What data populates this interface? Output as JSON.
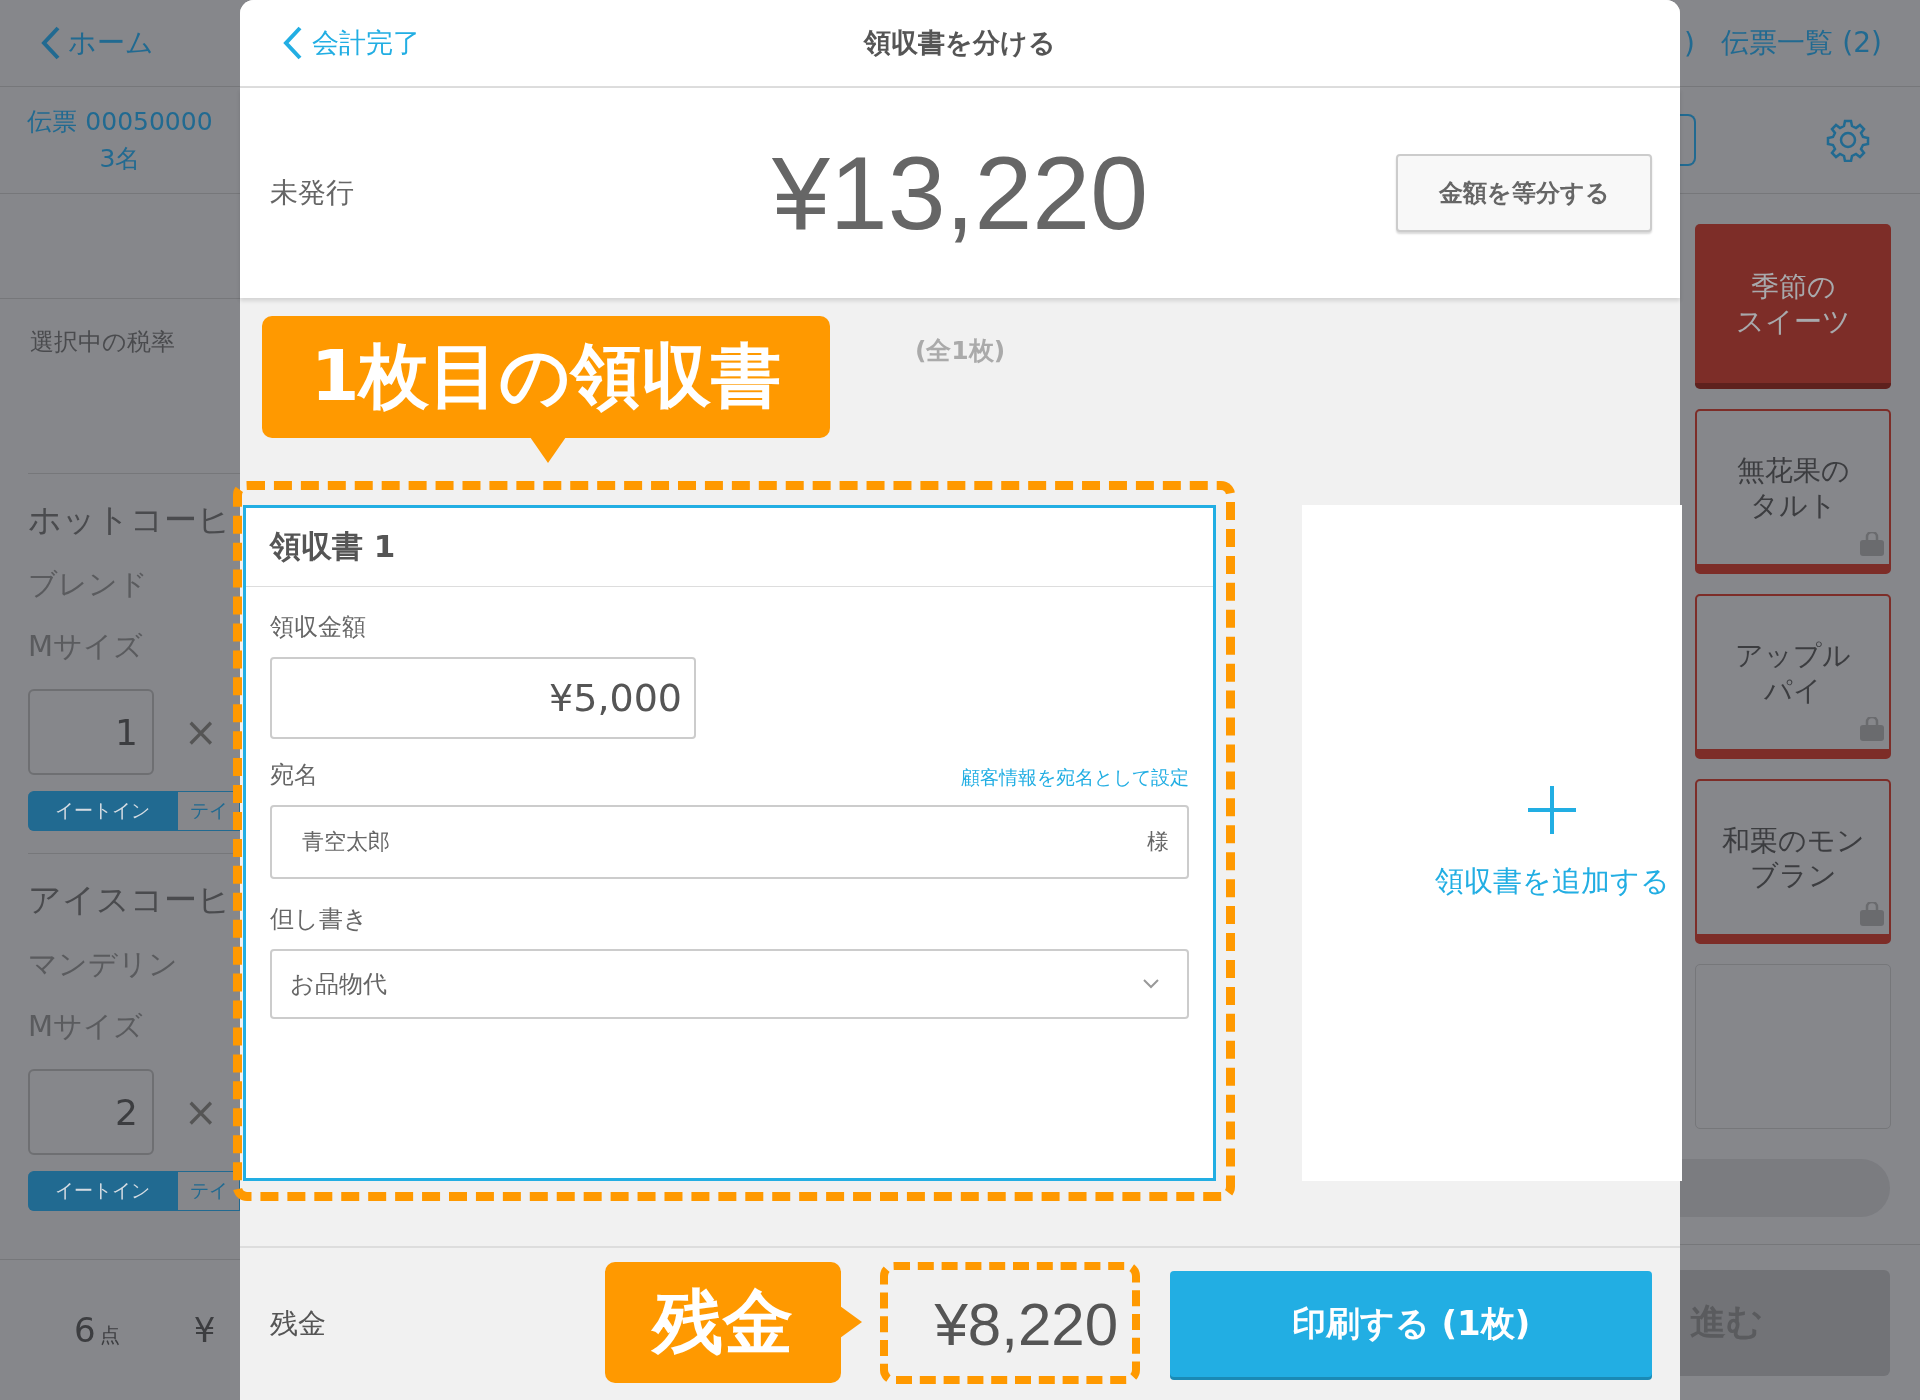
{
  "background": {
    "nav": {
      "back": "ホーム",
      "edge_text": ")",
      "list_link": "伝票一覧 (2)"
    },
    "slip": {
      "number": "伝票 00050000",
      "guests": "3名"
    },
    "tax_label": "選択中の税率",
    "items": [
      {
        "name": "ホットコーヒ",
        "options": [
          "ブレンド",
          "Mサイズ"
        ],
        "qty": "1",
        "times": "×",
        "modes": [
          {
            "label": "イートイン",
            "selected": true
          },
          {
            "label": "テイ",
            "selected": false
          }
        ]
      },
      {
        "name": "アイスコーヒ",
        "options": [
          "マンデリン",
          "Mサイズ"
        ],
        "qty": "2",
        "times": "×",
        "modes": [
          {
            "label": "イートイン",
            "selected": true
          },
          {
            "label": "テイ",
            "selected": false
          }
        ]
      }
    ],
    "total": {
      "count": "6",
      "unit": "点",
      "yen": "¥"
    },
    "tiles": [
      {
        "kind": "category",
        "lines": [
          "季節の",
          "スイーツ"
        ]
      },
      {
        "kind": "product",
        "lines": [
          "無花果の",
          "タルト"
        ]
      },
      {
        "kind": "product",
        "lines": [
          "アップル",
          "パイ"
        ]
      },
      {
        "kind": "product",
        "lines": [
          "和栗のモン",
          "ブラン"
        ]
      },
      {
        "kind": "empty"
      }
    ],
    "next_button": "進む"
  },
  "modal": {
    "back": "会計完了",
    "title": "領収書を分ける",
    "status": "未発行",
    "total": "¥13,220",
    "split_button": "金額を等分する",
    "count": "(全1枚)",
    "receipts": [
      {
        "title": "領収書 1",
        "amount_label": "領収金額",
        "amount": "¥5,000",
        "addressee_label": "宛名",
        "customer_link": "顧客情報を宛名として設定",
        "addressee": "青空太郎",
        "honorific": "様",
        "note_label": "但し書き",
        "note": "お品物代"
      }
    ],
    "add_receipt": "領収書を追加する",
    "footer": {
      "label": "残金",
      "amount": "¥8,220",
      "print_button": "印刷する (1枚)"
    }
  },
  "callouts": [
    {
      "text": "1枚目の領収書"
    },
    {
      "text": "残金"
    }
  ]
}
